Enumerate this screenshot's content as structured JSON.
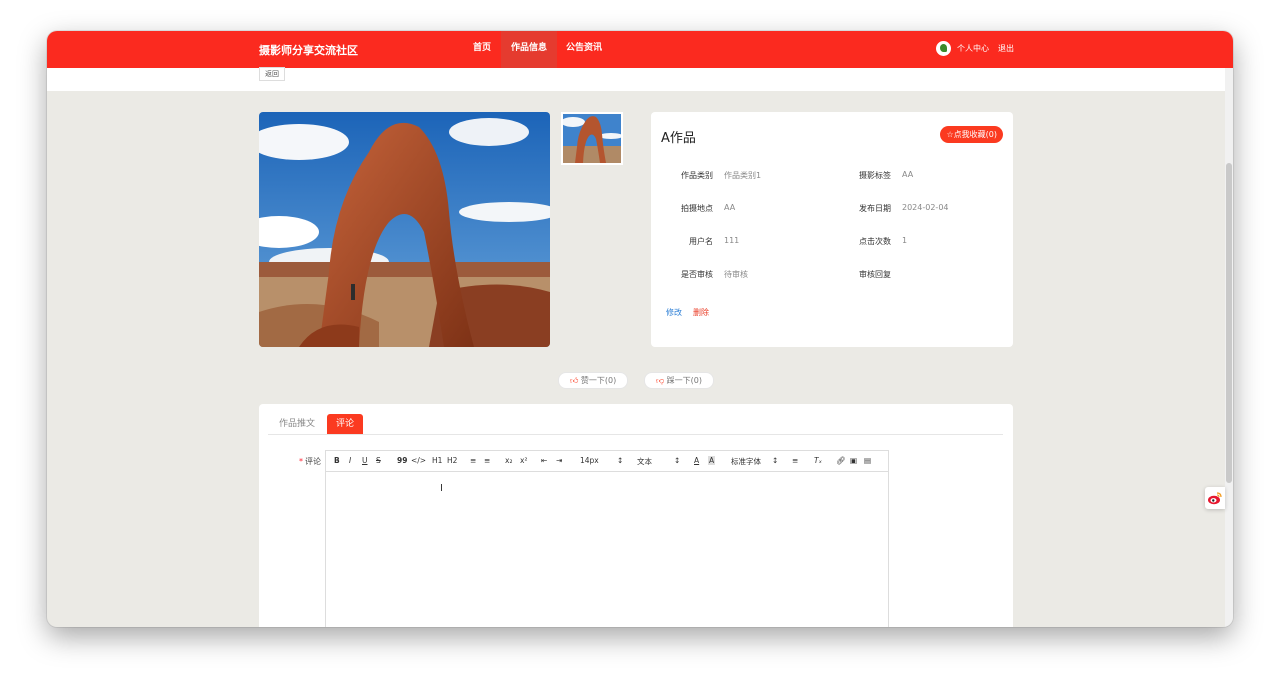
{
  "nav": {
    "brand": "摄影师分享交流社区",
    "items": [
      {
        "label": "首页"
      },
      {
        "label": "作品信息"
      },
      {
        "label": "公告资讯"
      }
    ],
    "user_center": "个人中心",
    "logout": "退出"
  },
  "subbar": {
    "back": "返回"
  },
  "work": {
    "title": "A作品",
    "favorite": "☆点我收藏(0)",
    "fields": [
      {
        "label": "作品类别",
        "value": "作品类别1"
      },
      {
        "label": "摄影标签",
        "value": "AA"
      },
      {
        "label": "拍摄地点",
        "value": "AA"
      },
      {
        "label": "发布日期",
        "value": "2024-02-04"
      },
      {
        "label": "用户名",
        "value": "111"
      },
      {
        "label": "点击次数",
        "value": "1"
      },
      {
        "label": "是否审核",
        "value": "待审核"
      },
      {
        "label": "审核回复",
        "value": ""
      }
    ],
    "edit": "修改",
    "delete": "删除"
  },
  "votes": {
    "up": "赞一下(0)",
    "down": "踩一下(0)"
  },
  "tabs": [
    {
      "label": "作品推文"
    },
    {
      "label": "评论"
    }
  ],
  "comment": {
    "required_mark": "*",
    "label": "评论",
    "toolbar": {
      "bold": "B",
      "italic": "I",
      "underline": "U",
      "strike": "S",
      "quote": "99",
      "code": "</>",
      "h1": "H1",
      "h2": "H2",
      "sub": "x₂",
      "sup": "x²",
      "size": "14px",
      "block": "文本",
      "font": "标准字体"
    }
  },
  "colors": {
    "accent": "#fb2a1f",
    "button": "#fb3a20",
    "link": "#2d7fd6",
    "danger": "#ea3b25"
  }
}
